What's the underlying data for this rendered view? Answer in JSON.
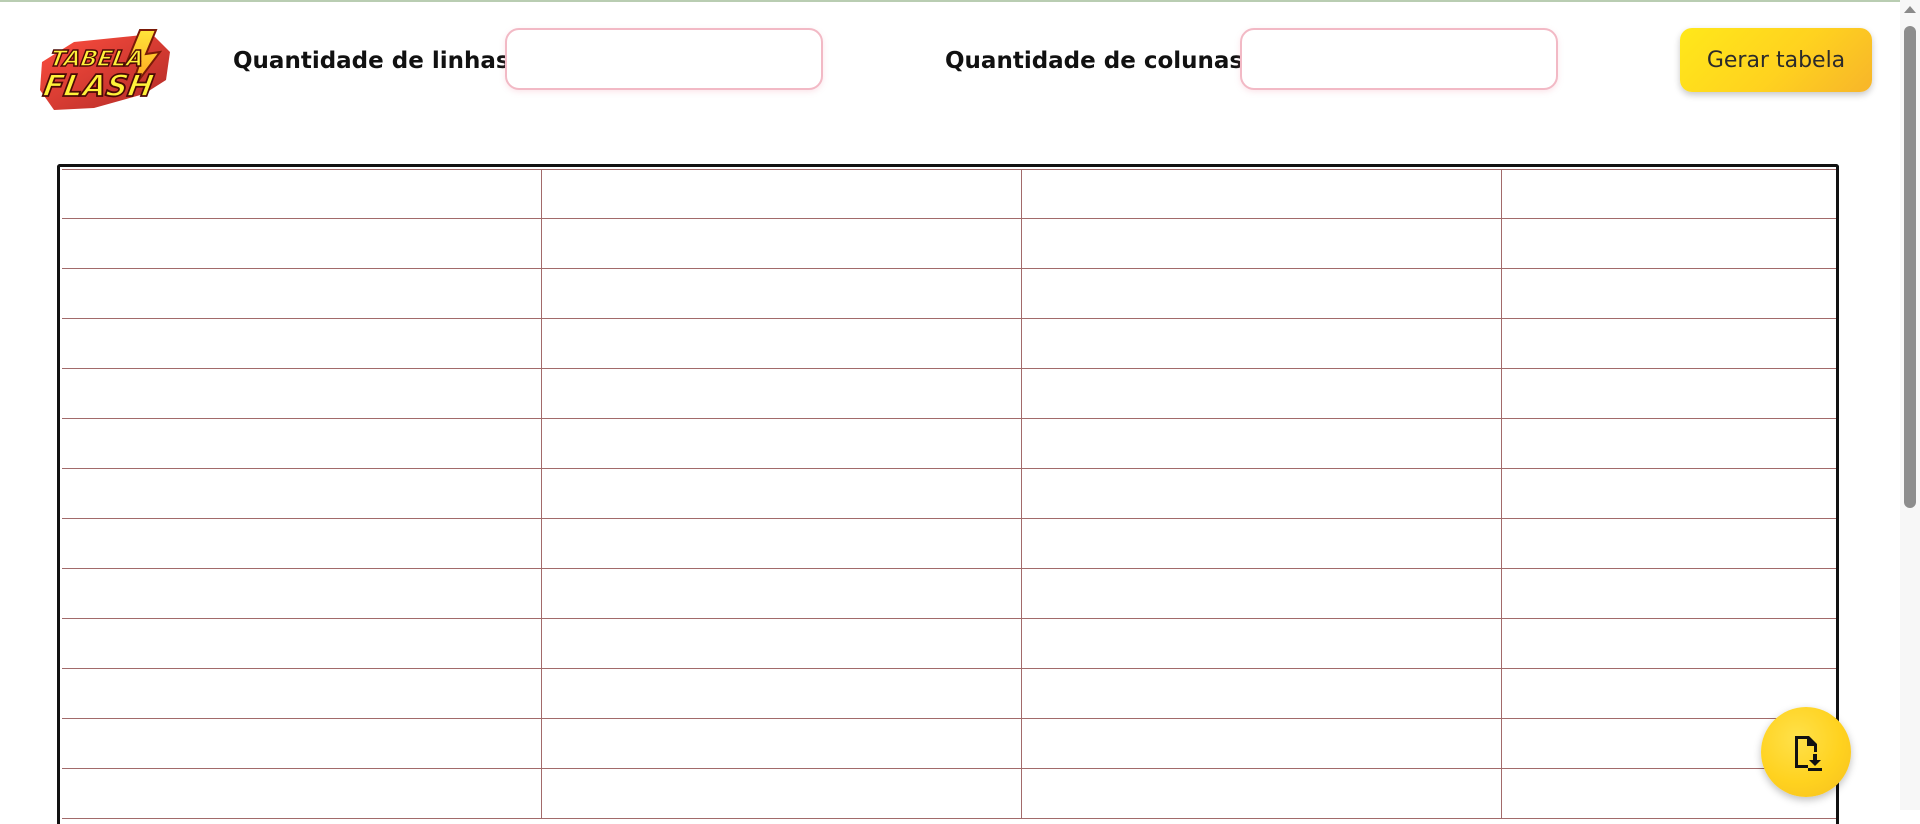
{
  "header": {
    "logo_line1": "TABELA",
    "logo_line2": "FLASH",
    "rows_label": "Quantidade de linhas:",
    "rows_value": "",
    "cols_label": "Quantidade de colunas:",
    "cols_value": "",
    "generate_label": "Gerar tabela"
  },
  "table": {
    "columns": 4,
    "rows": [
      [
        "",
        "",
        "",
        ""
      ],
      [
        "",
        "",
        "",
        ""
      ],
      [
        "",
        "",
        "",
        ""
      ],
      [
        "",
        "",
        "",
        ""
      ],
      [
        "",
        "",
        "",
        ""
      ],
      [
        "",
        "",
        "",
        ""
      ],
      [
        "",
        "",
        "",
        ""
      ],
      [
        "",
        "",
        "",
        ""
      ],
      [
        "",
        "",
        "",
        ""
      ],
      [
        "",
        "",
        "",
        ""
      ],
      [
        "",
        "",
        "",
        ""
      ],
      [
        "",
        "",
        "",
        ""
      ],
      [
        "",
        "",
        "",
        ""
      ]
    ]
  },
  "fab": {
    "icon": "file-download-icon"
  },
  "colors": {
    "accent_yellow": "#ffd21f",
    "input_border": "#f2b9c5",
    "grid_line": "#a26a6a"
  }
}
